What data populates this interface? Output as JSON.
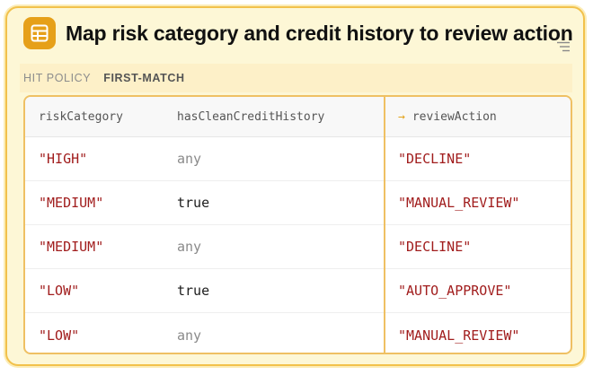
{
  "header": {
    "title": "Map risk category and credit history to review action"
  },
  "hit_policy": {
    "label": "HIT POLICY",
    "value": "FIRST-MATCH"
  },
  "table": {
    "columns": {
      "input1": "riskCategory",
      "input2": "hasCleanCreditHistory",
      "output_arrow": "→",
      "output": "reviewAction"
    },
    "rows": [
      {
        "riskCategory": "\"HIGH\"",
        "hasCleanCreditHistory": "any",
        "reviewAction": "\"DECLINE\""
      },
      {
        "riskCategory": "\"MEDIUM\"",
        "hasCleanCreditHistory": "true",
        "reviewAction": "\"MANUAL_REVIEW\""
      },
      {
        "riskCategory": "\"MEDIUM\"",
        "hasCleanCreditHistory": "any",
        "reviewAction": "\"DECLINE\""
      },
      {
        "riskCategory": "\"LOW\"",
        "hasCleanCreditHistory": "true",
        "reviewAction": "\"AUTO_APPROVE\""
      },
      {
        "riskCategory": "\"LOW\"",
        "hasCleanCreditHistory": "any",
        "reviewAction": "\"MANUAL_REVIEW\""
      }
    ]
  },
  "colors": {
    "accent": "#e6a019",
    "card_border": "#f2c14b",
    "card_background": "#fdf7d6",
    "string_value": "#a11d1d",
    "wildcard_value": "#8a8a8a"
  },
  "icons": {
    "table": "table-icon",
    "menu": "menu-lines-icon"
  }
}
